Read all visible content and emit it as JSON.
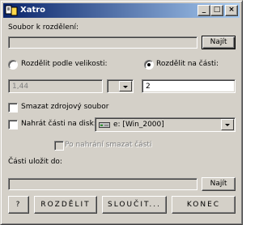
{
  "window": {
    "title": "Xatro",
    "minimize_glyph": "_",
    "maximize_glyph": "□",
    "close_glyph": "×"
  },
  "source": {
    "label": "Soubor k rozdělení:",
    "path_value": "",
    "browse_label": "Najít"
  },
  "mode": {
    "by_size_label": "Rozdělit podle velikosti:",
    "by_size_selected": false,
    "by_parts_label": "Rozdělit na části:",
    "by_parts_selected": true,
    "size_value": "1,44",
    "size_unit_value": "",
    "parts_value": "2"
  },
  "options": {
    "delete_source_label": "Smazat zdrojový soubor",
    "delete_source_checked": false,
    "upload_to_disk_label": "Nahrát části na disk:",
    "upload_to_disk_checked": false,
    "disk_value": "e: [Win_2000]",
    "delete_after_upload_label": "Po nahrání smazat části",
    "delete_after_upload_checked": false
  },
  "destination": {
    "label": "Části uložit do:",
    "path_value": "",
    "browse_label": "Najít"
  },
  "actions": {
    "help_label": "?",
    "split_label": "ROZDĚLIT",
    "join_label": "SLOUČIT...",
    "exit_label": "KONEC"
  },
  "colors": {
    "titlebar_start": "#0a246a",
    "titlebar_end": "#a6caf0",
    "window_face": "#d4d0c8"
  },
  "icons": {
    "app": "app-icon",
    "drive": "hard-drive-icon",
    "dropdown": "chevron-down-icon"
  }
}
